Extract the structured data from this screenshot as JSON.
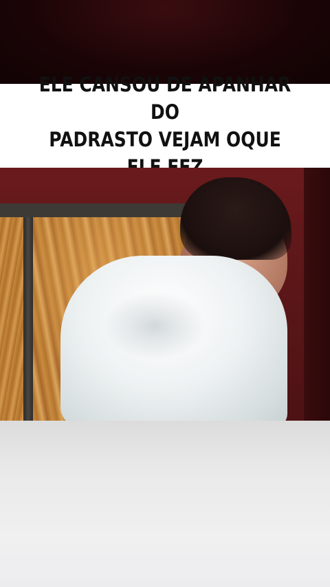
{
  "caption": {
    "text": "ELE CANSOU DE APANHAR DO\nPADRASTO VEJAM OQUE ELE FEZ"
  },
  "video": {
    "description_icon": "video-still"
  },
  "colors": {
    "banner_background": "#ffffff",
    "caption_text": "#111111",
    "wall": "#5a1618",
    "bottom_area": "#e9e9ea"
  }
}
